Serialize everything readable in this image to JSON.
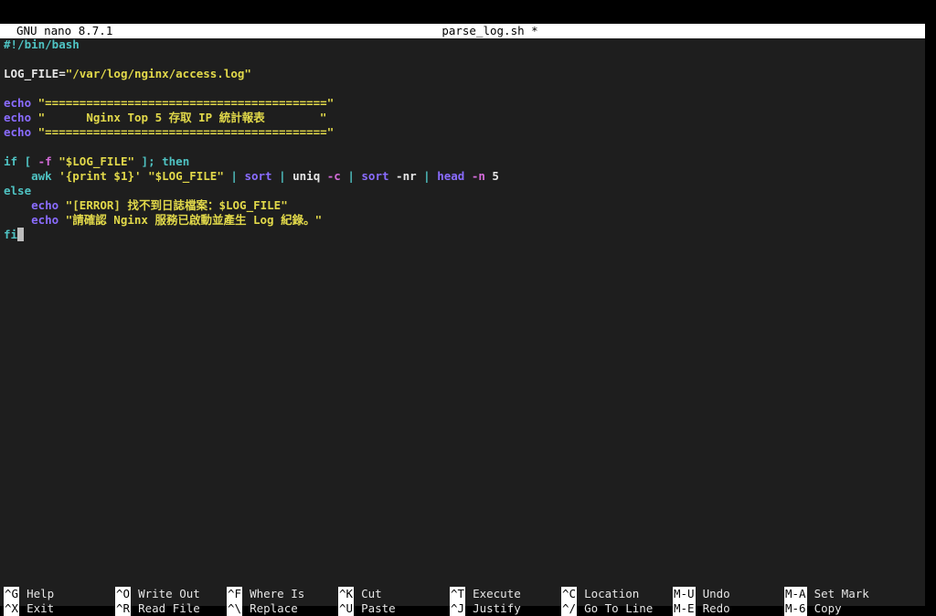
{
  "colors": {
    "keyword": "#8a6cff",
    "string": "#e2d94a",
    "comment": "#4fc3c3",
    "flag": "#d36bd8",
    "plain": "#e6e6e6",
    "titlebar_bg": "#ffffff",
    "terminal_bg": "#1e1e1e"
  },
  "titlebar": {
    "app": "GNU nano 8.7.1",
    "filename": "parse_log.sh *"
  },
  "lines": [
    [
      {
        "t": "#!/bin/bash",
        "c": "#4fc3c3"
      }
    ],
    [],
    [
      {
        "t": "LOG_FILE=",
        "c": "#e6e6e6"
      },
      {
        "t": "\"/var/log/nginx/access.log\"",
        "c": "#e2d94a"
      }
    ],
    [],
    [
      {
        "t": "echo",
        "c": "#8a6cff"
      },
      {
        "t": " \"=========================================\"",
        "c": "#e2d94a"
      }
    ],
    [
      {
        "t": "echo",
        "c": "#8a6cff"
      },
      {
        "t": " \"      Nginx Top 5 存取 IP 統計報表        \"",
        "c": "#e2d94a"
      }
    ],
    [
      {
        "t": "echo",
        "c": "#8a6cff"
      },
      {
        "t": " \"=========================================\"",
        "c": "#e2d94a"
      }
    ],
    [],
    [
      {
        "t": "if [ ",
        "c": "#4fc3c3"
      },
      {
        "t": "-f",
        "c": "#d36bd8"
      },
      {
        "t": " ",
        "c": "#e6e6e6"
      },
      {
        "t": "\"$LOG_FILE\"",
        "c": "#e2d94a"
      },
      {
        "t": " ]; then",
        "c": "#4fc3c3"
      }
    ],
    [
      {
        "t": "    awk ",
        "c": "#4fc3c3"
      },
      {
        "t": "'{print $1}'",
        "c": "#e2d94a"
      },
      {
        "t": " ",
        "c": "#e6e6e6"
      },
      {
        "t": "\"$LOG_FILE\"",
        "c": "#e2d94a"
      },
      {
        "t": " | ",
        "c": "#4fc3c3"
      },
      {
        "t": "sort",
        "c": "#8a6cff"
      },
      {
        "t": " | ",
        "c": "#4fc3c3"
      },
      {
        "t": "uniq ",
        "c": "#e6e6e6"
      },
      {
        "t": "-c",
        "c": "#d36bd8"
      },
      {
        "t": " | ",
        "c": "#4fc3c3"
      },
      {
        "t": "sort",
        "c": "#8a6cff"
      },
      {
        "t": " -nr",
        "c": "#e6e6e6"
      },
      {
        "t": " | ",
        "c": "#4fc3c3"
      },
      {
        "t": "head",
        "c": "#8a6cff"
      },
      {
        "t": " ",
        "c": "#e6e6e6"
      },
      {
        "t": "-n",
        "c": "#d36bd8"
      },
      {
        "t": " 5",
        "c": "#e6e6e6"
      }
    ],
    [
      {
        "t": "else",
        "c": "#4fc3c3"
      }
    ],
    [
      {
        "t": "    echo",
        "c": "#8a6cff"
      },
      {
        "t": " \"[ERROR] 找不到日誌檔案：$LOG_FILE\"",
        "c": "#e2d94a"
      }
    ],
    [
      {
        "t": "    echo",
        "c": "#8a6cff"
      },
      {
        "t": " \"請確認 Nginx 服務已啟動並產生 Log 紀錄。\"",
        "c": "#e2d94a"
      }
    ],
    [
      {
        "t": "fi",
        "c": "#4fc3c3"
      }
    ]
  ],
  "shortcuts": [
    {
      "key": "^G",
      "label": "Help",
      "name": "shortcut-help"
    },
    {
      "key": "^O",
      "label": "Write Out",
      "name": "shortcut-write-out"
    },
    {
      "key": "^F",
      "label": "Where Is",
      "name": "shortcut-where-is"
    },
    {
      "key": "^K",
      "label": "Cut",
      "name": "shortcut-cut"
    },
    {
      "key": "^T",
      "label": "Execute",
      "name": "shortcut-execute"
    },
    {
      "key": "^C",
      "label": "Location",
      "name": "shortcut-location"
    },
    {
      "key": "M-U",
      "label": "Undo",
      "name": "shortcut-undo"
    },
    {
      "key": "M-A",
      "label": "Set Mark",
      "name": "shortcut-set-mark"
    },
    {
      "key": "^X",
      "label": "Exit",
      "name": "shortcut-exit"
    },
    {
      "key": "^R",
      "label": "Read File",
      "name": "shortcut-read-file"
    },
    {
      "key": "^\\",
      "label": "Replace",
      "name": "shortcut-replace"
    },
    {
      "key": "^U",
      "label": "Paste",
      "name": "shortcut-paste"
    },
    {
      "key": "^J",
      "label": "Justify",
      "name": "shortcut-justify"
    },
    {
      "key": "^/",
      "label": "Go To Line",
      "name": "shortcut-go-to-line"
    },
    {
      "key": "M-E",
      "label": "Redo",
      "name": "shortcut-redo"
    },
    {
      "key": "M-6",
      "label": "Copy",
      "name": "shortcut-copy"
    }
  ]
}
